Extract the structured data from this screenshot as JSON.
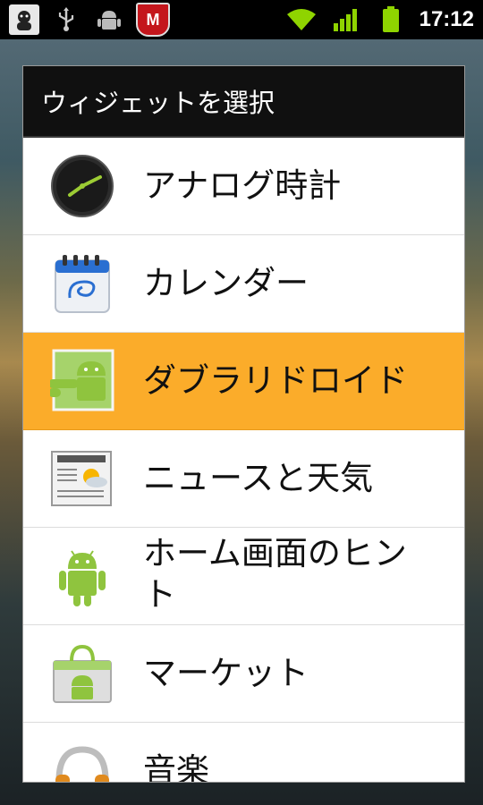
{
  "status_bar": {
    "left_icons": [
      "avatar-icon",
      "usb-icon",
      "debug-android-icon",
      "mcafee-icon"
    ],
    "right_icons": [
      "wifi-icon",
      "signal-icon",
      "battery-icon"
    ],
    "time": "17:12",
    "colors": {
      "wifi": "#8fd400",
      "signal": "#8fd400",
      "battery": "#8fd400"
    }
  },
  "dialog": {
    "title": "ウィジェットを選択",
    "items": [
      {
        "label": "アナログ時計",
        "icon": "analog-clock-icon",
        "selected": false
      },
      {
        "label": "カレンダー",
        "icon": "calendar-icon",
        "selected": false
      },
      {
        "label": "ダブラリドロイド",
        "icon": "droid-widget-icon",
        "selected": true
      },
      {
        "label": "ニュースと天気",
        "icon": "news-weather-icon",
        "selected": false
      },
      {
        "label": "ホーム画面のヒント",
        "icon": "android-robot-icon",
        "selected": false
      },
      {
        "label": "マーケット",
        "icon": "market-bag-icon",
        "selected": false
      },
      {
        "label": "音楽",
        "icon": "headphones-icon",
        "selected": false
      }
    ],
    "colors": {
      "selected": "#fbac2a",
      "title_bg": "#101010",
      "android_green": "#8fc43e"
    }
  }
}
